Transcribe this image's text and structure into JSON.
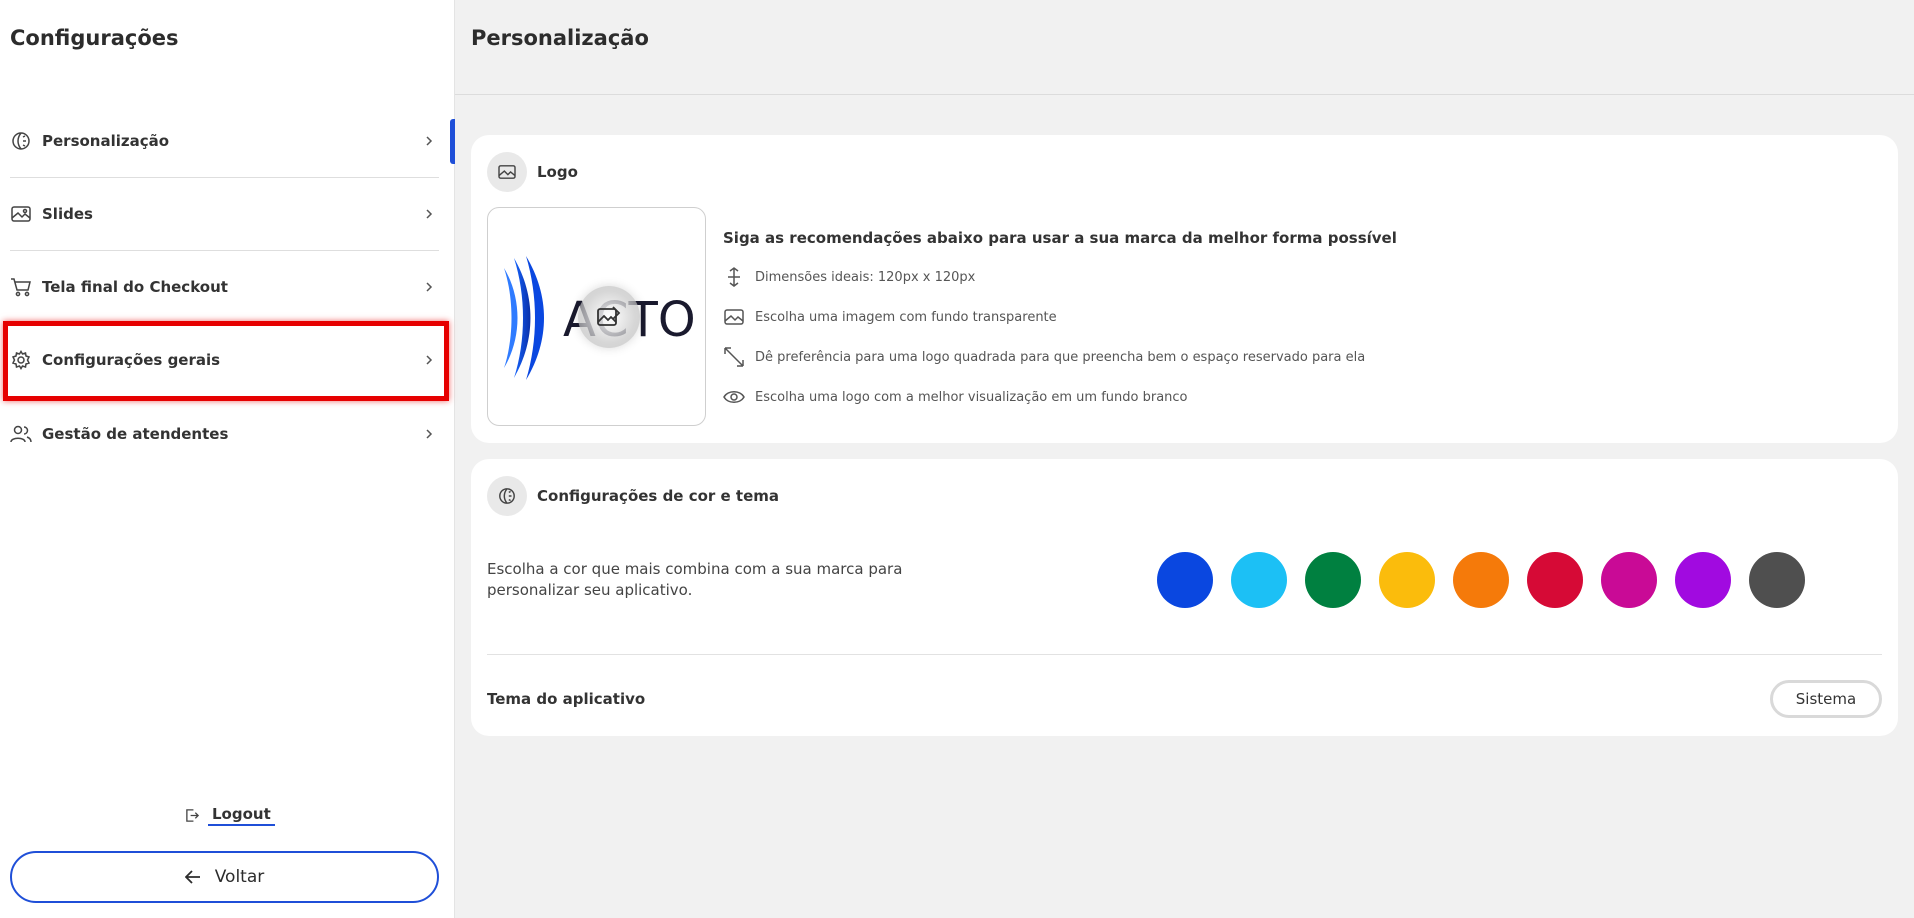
{
  "sidebar": {
    "title": "Configurações",
    "items": [
      {
        "label": "Personalização",
        "icon": "palette-icon"
      },
      {
        "label": "Slides",
        "icon": "image-icon"
      },
      {
        "label": "Tela final do Checkout",
        "icon": "cart-icon"
      },
      {
        "label": "Configurações gerais",
        "icon": "gear-icon"
      },
      {
        "label": "Gestão de atendentes",
        "icon": "users-icon"
      }
    ],
    "logout_label": "Logout",
    "back_label": "Voltar"
  },
  "main": {
    "title": "Personalização",
    "logo_card": {
      "title": "Logo",
      "logo_text": "ACTO",
      "recommendations_title": "Siga as recomendações abaixo para usar a sua marca da melhor forma possível",
      "recommendations": [
        {
          "icon": "resize-vertical-icon",
          "text": "Dimensões ideais: 120px x 120px"
        },
        {
          "icon": "image-icon",
          "text": "Escolha uma imagem com fundo transparente"
        },
        {
          "icon": "expand-diagonal-icon",
          "text": "Dê preferência para uma logo quadrada para que preencha bem o espaço reservado para ela"
        },
        {
          "icon": "eye-icon",
          "text": "Escolha uma logo com a melhor visualização em um fundo branco"
        }
      ]
    },
    "theme_card": {
      "title": "Configurações de cor e tema",
      "description": "Escolha a cor que mais combina com a sua marca para personalizar seu aplicativo.",
      "colors": [
        "#0a47e0",
        "#1cc0f5",
        "#008040",
        "#fbbc0c",
        "#f57a0a",
        "#d60a36",
        "#c90a96",
        "#a10ae0",
        "#4f4f4f"
      ],
      "app_theme_label": "Tema do aplicativo",
      "app_theme_value": "Sistema"
    }
  }
}
